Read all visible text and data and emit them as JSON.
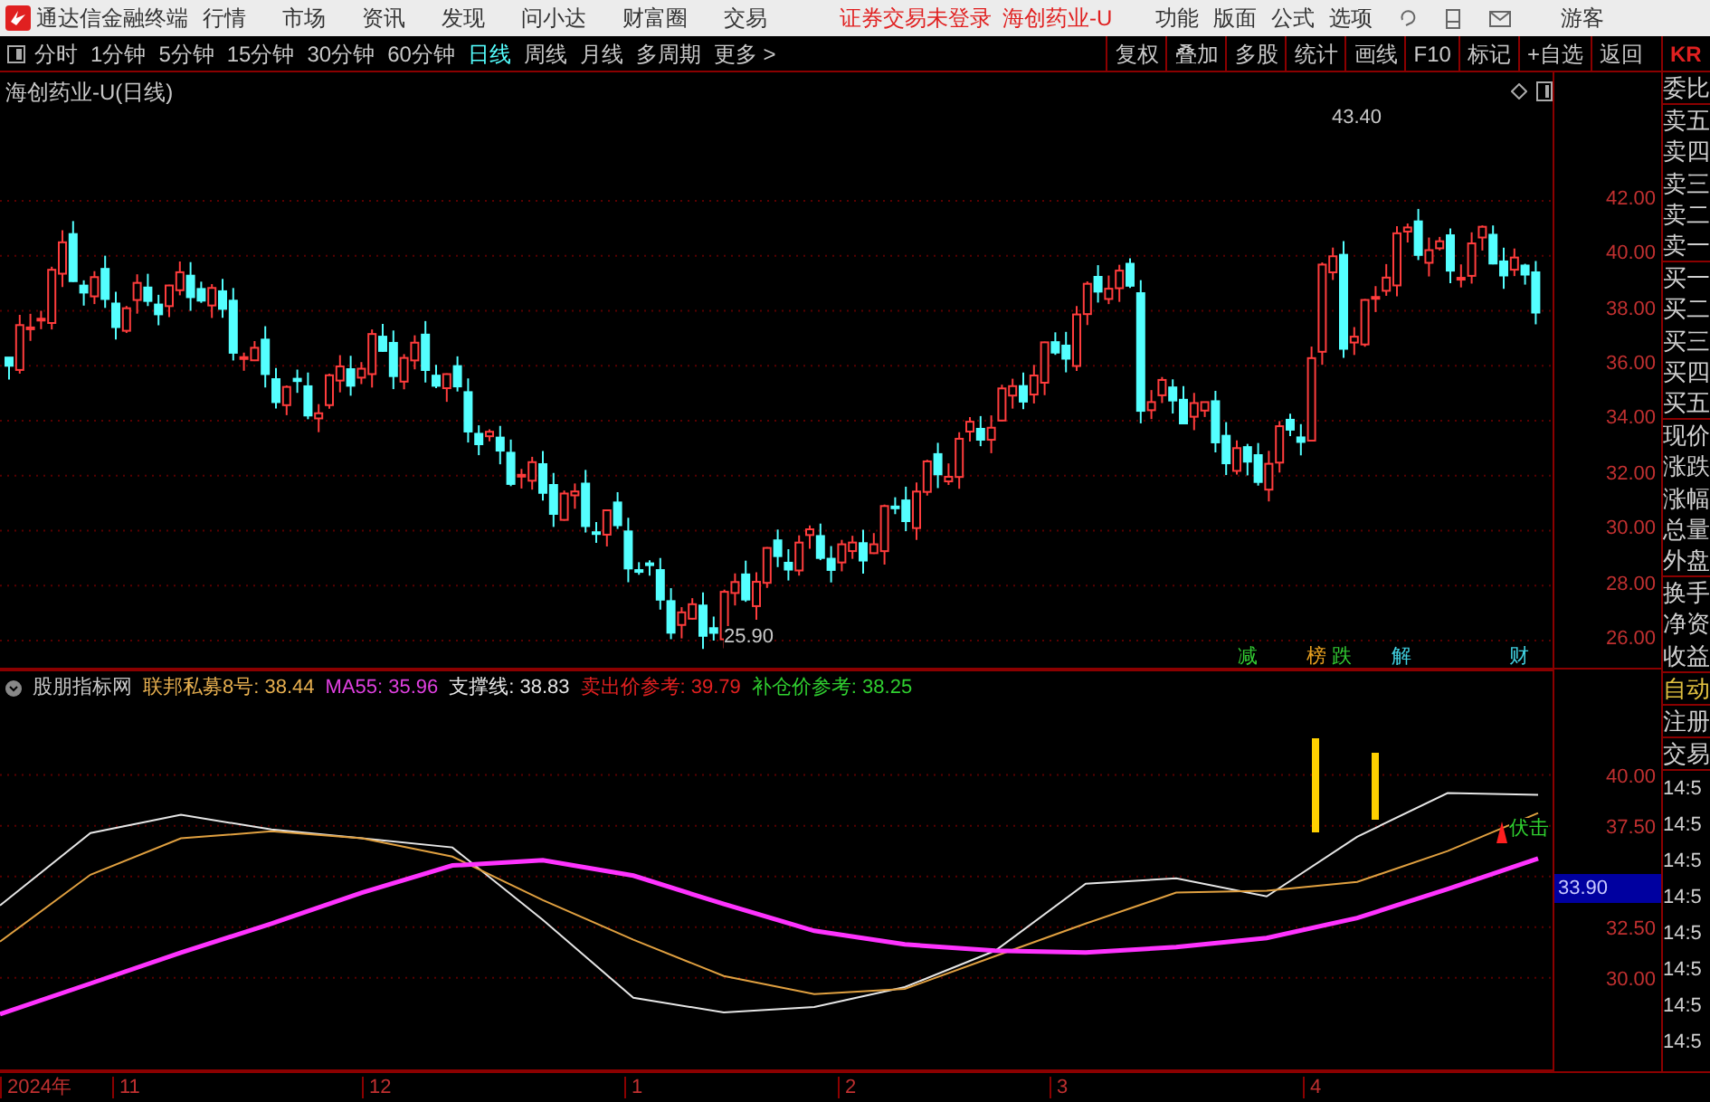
{
  "app": {
    "title": "通达信金融终端",
    "menus": [
      "行情",
      "市场",
      "资讯",
      "发现",
      "问小达",
      "财富圈",
      "交易"
    ],
    "status": [
      "证券交易未登录",
      "海创药业-U"
    ],
    "right_menus": [
      "功能",
      "版面",
      "公式",
      "选项"
    ],
    "user": "游客"
  },
  "periods": [
    {
      "label": "分时",
      "selected": false
    },
    {
      "label": "1分钟",
      "selected": false
    },
    {
      "label": "5分钟",
      "selected": false
    },
    {
      "label": "15分钟",
      "selected": false
    },
    {
      "label": "30分钟",
      "selected": false
    },
    {
      "label": "60分钟",
      "selected": false
    },
    {
      "label": "日线",
      "selected": true
    },
    {
      "label": "周线",
      "selected": false
    },
    {
      "label": "月线",
      "selected": false
    },
    {
      "label": "多周期",
      "selected": false
    },
    {
      "label": "更多 >",
      "selected": false
    }
  ],
  "tools": [
    "复权",
    "叠加",
    "多股",
    "统计",
    "画线",
    "F10",
    "标记",
    "+自选",
    "返回"
  ],
  "corner": "KR",
  "main_chart": {
    "title": "海创药业-U(日线)",
    "high_label": "43.40",
    "low_label": "25.90",
    "y_labels": [
      "42.00",
      "40.00",
      "38.00",
      "36.00",
      "34.00",
      "32.00",
      "30.00",
      "28.00",
      "26.00"
    ],
    "markers": [
      {
        "text": "减",
        "color": "#33cc33"
      },
      {
        "text": "榜",
        "color": "#e8a020"
      },
      {
        "text": "跌",
        "color": "#33cc33"
      },
      {
        "text": "解",
        "color": "#40d0e0"
      },
      {
        "text": "财",
        "color": "#40d0e0"
      }
    ]
  },
  "indicator": {
    "name": "股朋指标网",
    "values": [
      {
        "text": "联邦私募8号: 38.44",
        "color": "#e8b050"
      },
      {
        "text": "MA55: 35.96",
        "color": "#e040e0"
      },
      {
        "text": "支撑线: 38.83",
        "color": "#e6e6e6"
      },
      {
        "text": "卖出价参考: 39.79",
        "color": "#e02020"
      },
      {
        "text": "补仓价参考: 38.25",
        "color": "#30d030"
      }
    ],
    "chart_data": {
      "type": "line",
      "ylim": [
        25.4,
        45.2
      ],
      "grid": true,
      "yticks": [
        {
          "value": 40,
          "label": "40.00"
        },
        {
          "value": 37.5,
          "label": "37.50"
        },
        {
          "value": 32.5,
          "label": "32.50"
        },
        {
          "value": 30,
          "label": "30.00"
        }
      ],
      "series": [
        {
          "color": "#e6e6e6",
          "values": [
            33.57,
            37.14,
            38.04,
            37.32,
            36.88,
            36.43,
            32.86,
            29.02,
            28.3,
            28.57,
            29.55,
            31.34,
            34.64,
            34.91,
            34.02,
            36.96,
            39.11,
            39.02
          ]
        },
        {
          "color": "#e0a040",
          "values": [
            31.79,
            35.09,
            36.88,
            37.23,
            36.88,
            35.98,
            33.84,
            31.88,
            30.09,
            29.2,
            29.46,
            31.07,
            32.68,
            34.2,
            34.29,
            34.73,
            36.25,
            38.13
          ]
        },
        {
          "color": "#ff33ff",
          "values": [
            28.21,
            29.73,
            31.25,
            32.68,
            34.2,
            35.54,
            35.8,
            35.04,
            33.64,
            32.32,
            31.65,
            31.34,
            31.25,
            31.52,
            31.96,
            32.95,
            34.38,
            35.89
          ]
        }
      ]
    },
    "signal": "伏击",
    "current": "33.90"
  },
  "quote_panel": {
    "groups": [
      [
        {
          "label": "委比",
          "kind": "plain"
        }
      ],
      [
        {
          "label": "卖五",
          "kind": "plain"
        },
        {
          "label": "卖四",
          "kind": "plain"
        },
        {
          "label": "卖三",
          "kind": "plain"
        },
        {
          "label": "卖二",
          "kind": "plain"
        },
        {
          "label": "卖一",
          "kind": "plain"
        }
      ],
      [
        {
          "label": "买一",
          "kind": "plain"
        },
        {
          "label": "买二",
          "kind": "plain"
        },
        {
          "label": "买三",
          "kind": "plain"
        },
        {
          "label": "买四",
          "kind": "plain"
        },
        {
          "label": "买五",
          "kind": "plain"
        }
      ],
      [
        {
          "label": "现价",
          "kind": "plain"
        },
        {
          "label": "涨跌",
          "kind": "plain"
        },
        {
          "label": "涨幅",
          "kind": "plain"
        },
        {
          "label": "总量",
          "kind": "plain"
        },
        {
          "label": "外盘",
          "kind": "plain"
        }
      ],
      [
        {
          "label": "换手",
          "kind": "plain"
        },
        {
          "label": "净资",
          "kind": "plain"
        },
        {
          "label": "收益",
          "kind": "plain"
        }
      ],
      [
        {
          "label": "自动",
          "kind": "active"
        }
      ],
      [
        {
          "label": "注册",
          "kind": "plain"
        }
      ],
      [
        {
          "label": "交易",
          "kind": "plain"
        }
      ]
    ],
    "times": [
      "14:5",
      "14:5",
      "14:5",
      "14:5",
      "14:5",
      "14:5",
      "14:5",
      "14:5"
    ]
  },
  "time_axis": [
    "2024年",
    "11",
    "12",
    "1",
    "2",
    "3",
    "4"
  ]
}
